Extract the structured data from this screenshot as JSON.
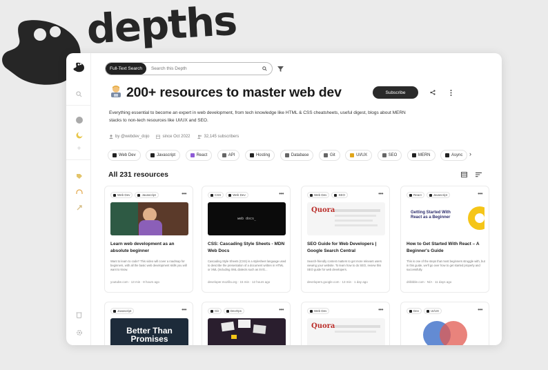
{
  "brand": {
    "name": "depths"
  },
  "search": {
    "mode_label": "Full-Text Search",
    "placeholder": "Search this Depth"
  },
  "header": {
    "title": "200+ resources to master web dev",
    "subscribe_label": "Subscribe"
  },
  "description": "Everything essential to become an expert in web development, from tech knowledge like HTML & CSS cheatsheets, useful digest, blogs about MERN stacks to non-tech resources like UI/UX and SEO.",
  "meta": {
    "author": "by @webdev_dojo",
    "since": "since Oct 2022",
    "subscribers": "32,145 subscribers"
  },
  "tags": [
    {
      "label": "Web Dev",
      "color": "#222"
    },
    {
      "label": "Javascript",
      "color": "#222"
    },
    {
      "label": "React",
      "color": "#8e5bd6"
    },
    {
      "label": "API",
      "color": "#666"
    },
    {
      "label": "Hosting",
      "color": "#222"
    },
    {
      "label": "Database",
      "color": "#666"
    },
    {
      "label": "Git",
      "color": "#666"
    },
    {
      "label": "UI/UX",
      "color": "#e0a51a"
    },
    {
      "label": "SEO",
      "color": "#666"
    },
    {
      "label": "MERN",
      "color": "#222"
    },
    {
      "label": "Async",
      "color": "#222"
    }
  ],
  "resources": {
    "count_label": "All 231 resources"
  },
  "cards": [
    {
      "tags": [
        "Web Dev",
        "Javascript"
      ],
      "title": "Learn web development as an absolute beginner",
      "desc": "Want to learn to code? This video will cover a roadmap for beginners, with all the basic web development skills you will want to know.",
      "meta": "youtube.com · 13 min · 8 hours ago",
      "thumb_text": ""
    },
    {
      "tags": [
        "CSS",
        "Web Dev"
      ],
      "title": "CSS: Cascading Style Sheets - MDN Web Docs",
      "desc": "Cascading Style Sheets (CSS) is a stylesheet language used to describe the presentation of a document written in HTML or XML (including XML dialects such as SVG...",
      "meta": "developer.mozilla.org · 15 min · 12 hours ago",
      "thumb_text": "web docs_"
    },
    {
      "tags": [
        "Web Dev",
        "SEO"
      ],
      "title": "SEO Guide for Web Developers | Google Search Central",
      "desc": "Search-friendly content matters to get more relevant users viewing your website. To learn how to do SEO, review this SEO guide for web developers.",
      "meta": "developers.google.com · 13 min · 1 day ago",
      "thumb_text": "Quora"
    },
    {
      "tags": [
        "React",
        "Javascript"
      ],
      "title": "How to Get Started With React – A Beginner's Guide",
      "desc": "This is one of the steps that most beginners struggle with, but in this guide, we'll go over how to get started properly and successfully.",
      "meta": "dribbble.com · N/A · 11 days ago",
      "thumb_text": "Getting Started With React as a Beginner"
    },
    {
      "tags": [
        "Javascript"
      ],
      "title": "",
      "desc": "",
      "meta": "",
      "thumb_text": "Better Than Promises"
    },
    {
      "tags": [
        "Git",
        "DevOps"
      ],
      "title": "",
      "desc": "",
      "meta": "",
      "thumb_text": ""
    },
    {
      "tags": [
        "Web Dev"
      ],
      "title": "",
      "desc": "",
      "meta": "",
      "thumb_text": "Quora"
    },
    {
      "tags": [
        "Dev",
        "UI/UX"
      ],
      "title": "",
      "desc": "",
      "meta": "",
      "thumb_text": ""
    }
  ]
}
